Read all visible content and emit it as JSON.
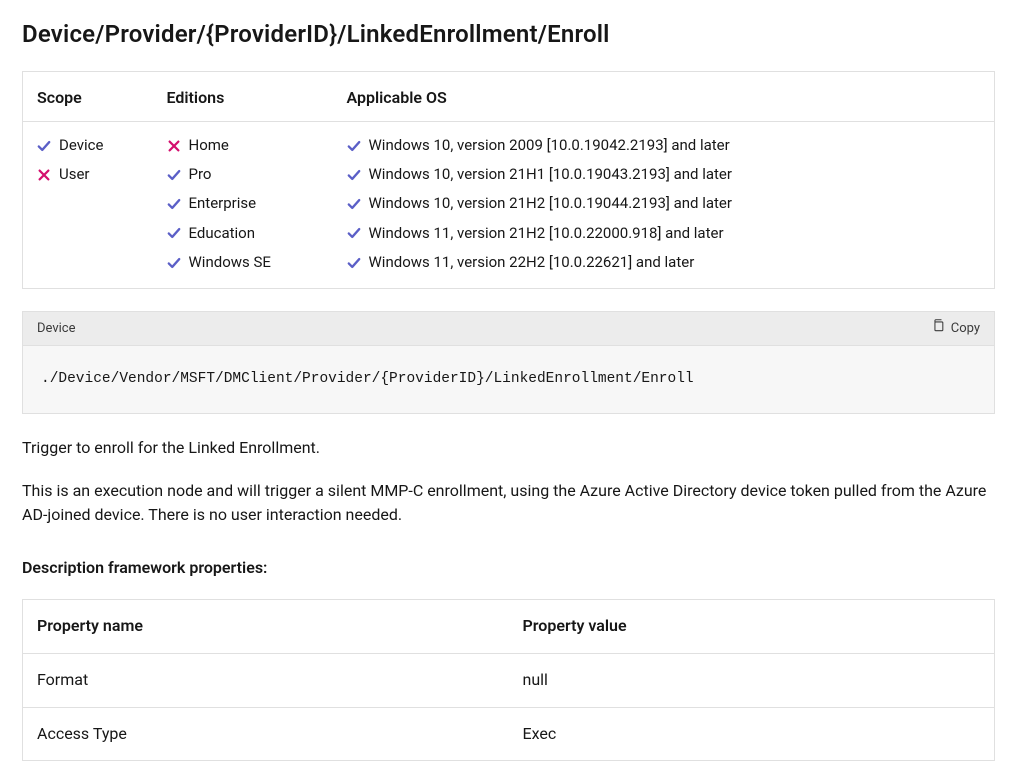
{
  "title": "Device/Provider/{ProviderID}/LinkedEnrollment/Enroll",
  "applicability": {
    "headers": {
      "scope": "Scope",
      "editions": "Editions",
      "os": "Applicable OS"
    },
    "scope": [
      {
        "label": "Device",
        "ok": true
      },
      {
        "label": "User",
        "ok": false
      }
    ],
    "editions": [
      {
        "label": "Home",
        "ok": false
      },
      {
        "label": "Pro",
        "ok": true
      },
      {
        "label": "Enterprise",
        "ok": true
      },
      {
        "label": "Education",
        "ok": true
      },
      {
        "label": "Windows SE",
        "ok": true
      }
    ],
    "os": [
      {
        "label": "Windows 10, version 2009 [10.0.19042.2193] and later",
        "ok": true
      },
      {
        "label": "Windows 10, version 21H1 [10.0.19043.2193] and later",
        "ok": true
      },
      {
        "label": "Windows 10, version 21H2 [10.0.19044.2193] and later",
        "ok": true
      },
      {
        "label": "Windows 11, version 21H2 [10.0.22000.918] and later",
        "ok": true
      },
      {
        "label": "Windows 11, version 22H2 [10.0.22621] and later",
        "ok": true
      }
    ]
  },
  "code": {
    "lang": "Device",
    "copy": "Copy",
    "content": "./Device/Vendor/MSFT/DMClient/Provider/{ProviderID}/LinkedEnrollment/Enroll"
  },
  "paragraphs": {
    "p1": "Trigger to enroll for the Linked Enrollment.",
    "p2": "This is an execution node and will trigger a silent MMP-C enrollment, using the Azure Active Directory device token pulled from the Azure AD-joined device. There is no user interaction needed."
  },
  "props_section_label": "Description framework properties:",
  "props": {
    "headers": {
      "name": "Property name",
      "value": "Property value"
    },
    "rows": [
      {
        "name": "Format",
        "value": "null"
      },
      {
        "name": "Access Type",
        "value": "Exec"
      }
    ]
  },
  "icons": {
    "check_color": "#5b5fc7",
    "cross_color": "#d40f6e"
  }
}
